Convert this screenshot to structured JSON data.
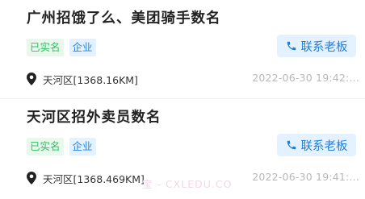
{
  "listings": [
    {
      "title": "广州招饿了么、美团骑手数名",
      "tags": [
        "已实名",
        "企业"
      ],
      "contact_label": "联系老板",
      "location": "天河区[1368.16KM]",
      "date": "2022-06-30 19:42:..."
    },
    {
      "title": "天河区招外卖员数名",
      "tags": [
        "已实名",
        "企业"
      ],
      "contact_label": "联系老板",
      "location": "天河区[1368.469KM]",
      "date": "2022-06-30 19:41:..."
    }
  ],
  "watermark": "宝 - CXLEDU.CO",
  "colors": {
    "accent": "#1f7fdd",
    "verified": "#2fbf63",
    "muted": "#b8b8b8"
  },
  "icons": {
    "contact": "phone-icon",
    "location": "location-pin-icon"
  }
}
